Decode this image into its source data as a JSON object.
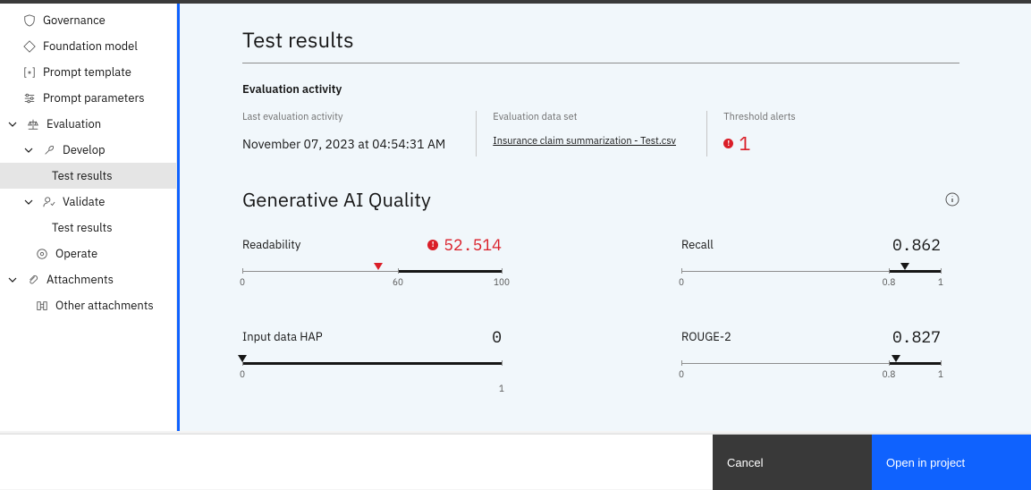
{
  "sidebar": {
    "items": [
      {
        "label": "Governance",
        "icon": "shield"
      },
      {
        "label": "Foundation model",
        "icon": "diamond"
      },
      {
        "label": "Prompt template",
        "icon": "brackets"
      },
      {
        "label": "Prompt parameters",
        "icon": "sliders"
      }
    ],
    "evaluation_label": "Evaluation",
    "develop_label": "Develop",
    "test_results_label": "Test results",
    "validate_label": "Validate",
    "validate_sub_label": "Test results",
    "operate_label": "Operate",
    "attachments_label": "Attachments",
    "other_attachments_label": "Other attachments"
  },
  "main": {
    "title": "Test results",
    "activity_section": "Evaluation activity",
    "last_activity_label": "Last evaluation activity",
    "last_activity_value": "November 07, 2023 at 04:54:31 AM",
    "dataset_label": "Evaluation data set",
    "dataset_value": "Insurance claim summarization - Test.csv",
    "alerts_label": "Threshold alerts",
    "alerts_count": "1",
    "quality_title": "Generative AI Quality",
    "metrics": {
      "readability": {
        "name": "Readability",
        "value": "52.514",
        "alert": true,
        "range": {
          "min": 0,
          "mid": 60,
          "max": 100
        },
        "labels": {
          "min": "0",
          "mid": "60",
          "max": "100"
        },
        "marker_at": 52.514,
        "fill_from": 60,
        "fill_to": 100,
        "marker_color": "red"
      },
      "recall": {
        "name": "Recall",
        "value": "0.862",
        "alert": false,
        "range": {
          "min": 0,
          "mid": 0.8,
          "max": 1
        },
        "labels": {
          "min": "0",
          "mid": "0.8",
          "max": "1"
        },
        "marker_at": 0.862,
        "fill_from": 0.8,
        "fill_to": 1,
        "marker_color": "black"
      },
      "input_hap": {
        "name": "Input data HAP",
        "value": "0",
        "alert": false,
        "range": {
          "min": 0,
          "max": 1
        },
        "labels": {
          "single": "1"
        },
        "marker_at": 0,
        "fill_from": 0,
        "fill_to": 1,
        "marker_color": "black"
      },
      "rouge2": {
        "name": "ROUGE-2",
        "value": "0.827",
        "alert": false,
        "range": {
          "min": 0,
          "mid": 0.8,
          "max": 1
        },
        "labels": {
          "min": "0",
          "mid": "0.8",
          "max": "1"
        },
        "marker_at": 0.827,
        "fill_from": 0.8,
        "fill_to": 1,
        "marker_color": "black"
      }
    }
  },
  "footer": {
    "cancel": "Cancel",
    "open": "Open in project"
  }
}
